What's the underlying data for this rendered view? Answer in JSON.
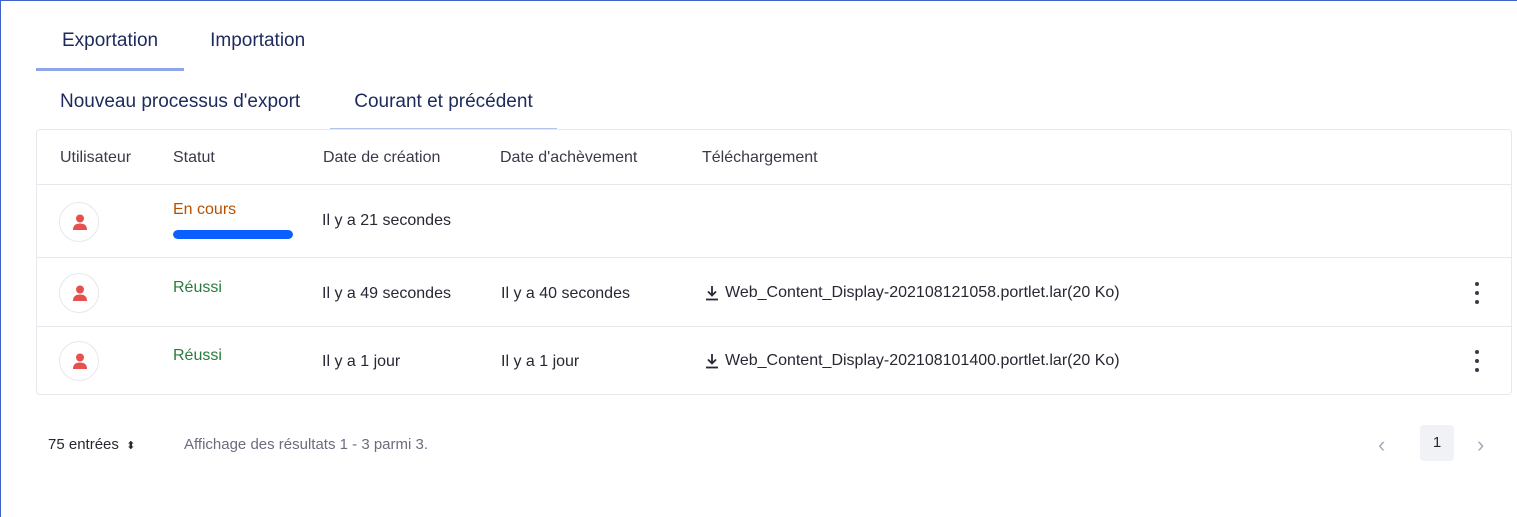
{
  "tabs": [
    {
      "label": "Exportation",
      "active": true
    },
    {
      "label": "Importation",
      "active": false
    }
  ],
  "subtabs": [
    {
      "label": "Nouveau processus d'export",
      "active": false
    },
    {
      "label": "Courant et précédent",
      "active": true
    }
  ],
  "table": {
    "headers": [
      "Utilisateur",
      "Statut",
      "Date de création",
      "Date d'achèvement",
      "Téléchargement"
    ],
    "rows": [
      {
        "status": "En cours",
        "status_type": "in-progress",
        "created": "Il y a 21 secondes",
        "completed": "",
        "download": "",
        "progress": 1.0
      },
      {
        "status": "Réussi",
        "status_type": "success",
        "created": "Il y a 49 secondes",
        "completed": "Il y a 40 secondes",
        "download": "Web_Content_Display-202108121058.portlet.lar(20 Ko)"
      },
      {
        "status": "Réussi",
        "status_type": "success",
        "created": "Il y a 1 jour",
        "completed": "Il y a 1 jour",
        "download": "Web_Content_Display-202108101400.portlet.lar(20 Ko)"
      }
    ]
  },
  "footer": {
    "per_page": "75 entrées",
    "results": "Affichage des résultats 1 - 3 parmi 3.",
    "current_page": "1"
  },
  "icons": {
    "avatar": "user-icon",
    "download": "download-icon",
    "actions": "vertical-ellipsis-icon",
    "per_page_toggle": "caret-double-icon",
    "prev": "chevron-left-icon",
    "next": "chevron-right-icon"
  },
  "colors": {
    "accent": "#0b5fff",
    "in_progress": "#b95000",
    "success": "#287d3c",
    "avatar_icon": "#e6504e"
  }
}
